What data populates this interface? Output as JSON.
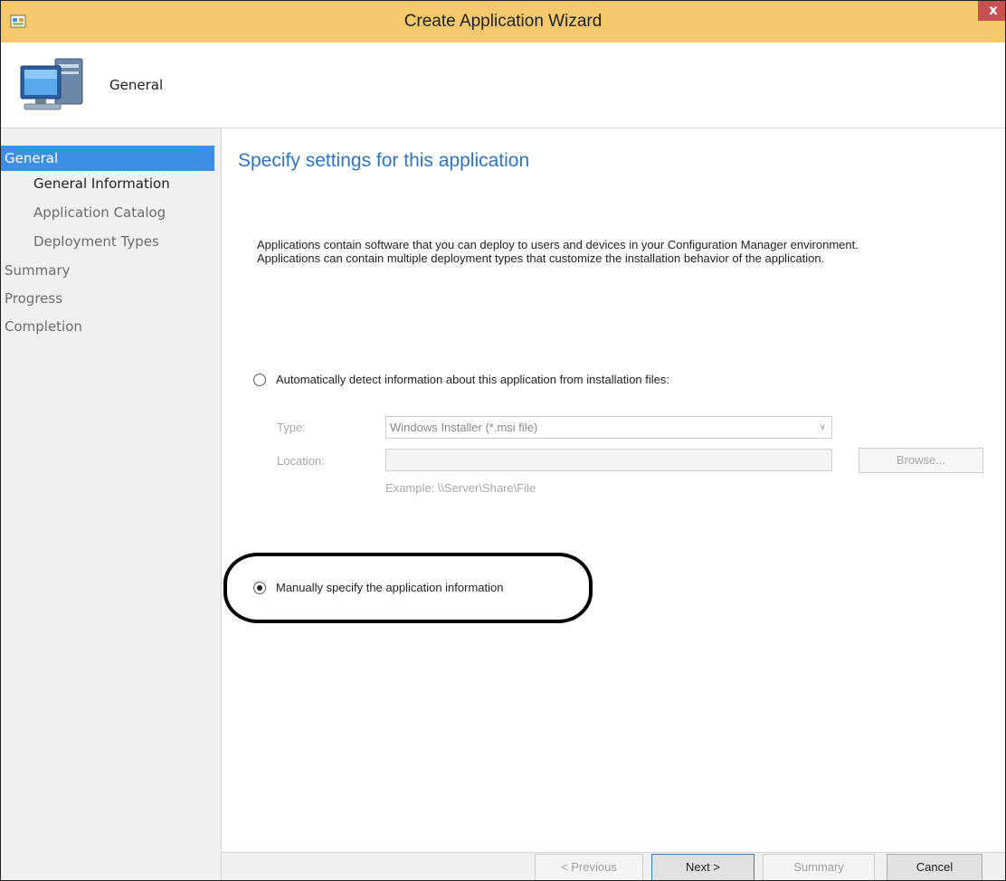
{
  "window": {
    "title": "Create Application Wizard",
    "close_label": "x"
  },
  "header": {
    "title": "General"
  },
  "nav": {
    "items": [
      {
        "label": "General"
      },
      {
        "label": "General Information"
      },
      {
        "label": "Application Catalog"
      },
      {
        "label": "Deployment Types"
      },
      {
        "label": "Summary"
      },
      {
        "label": "Progress"
      },
      {
        "label": "Completion"
      }
    ]
  },
  "content": {
    "heading": "Specify settings for this application",
    "description_line1": "Applications contain software that you can deploy to users and devices in your Configuration Manager environment.",
    "description_line2": "Applications can contain multiple deployment types that customize the installation behavior of the application.",
    "auto_detect": {
      "label": "Automatically detect information about this application from installation files:",
      "type_label": "Type:",
      "type_value": "Windows Installer (*.msi file)",
      "location_label": "Location:",
      "location_value": "",
      "browse_label": "Browse...",
      "example": "Example: \\\\Server\\Share\\File"
    },
    "manual": {
      "label": "Manually specify the application information"
    }
  },
  "footer": {
    "previous": "< Previous",
    "next": "Next >",
    "summary": "Summary",
    "cancel": "Cancel"
  },
  "colors": {
    "title_bar": "#f3c96b",
    "nav_selected": "#3c8fe4",
    "heading": "#2e74c2",
    "close_button": "#c75050"
  },
  "icons": [
    "app-icon",
    "computer-icon",
    "chevron-down-icon",
    "close-icon"
  ]
}
